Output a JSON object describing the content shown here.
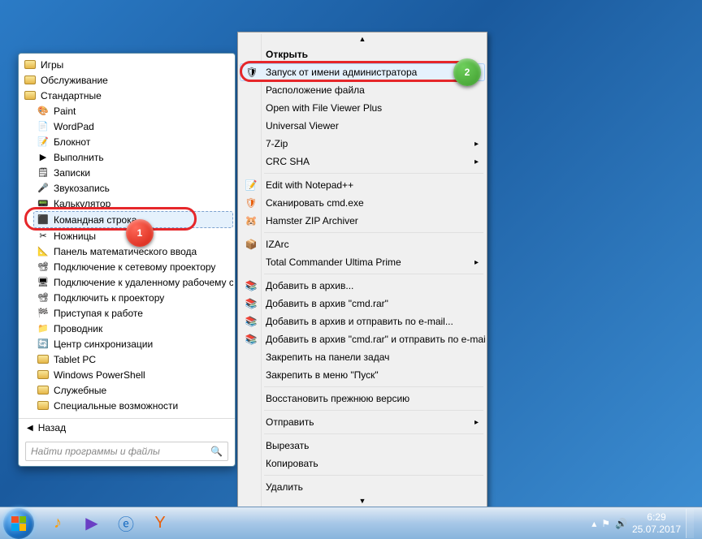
{
  "start_menu": {
    "folders_top": [
      "Игры",
      "Обслуживание",
      "Стандартные"
    ],
    "programs": [
      {
        "label": "Paint",
        "icon": "🎨"
      },
      {
        "label": "WordPad",
        "icon": "📄"
      },
      {
        "label": "Блокнот",
        "icon": "📝"
      },
      {
        "label": "Выполнить",
        "icon": "▶"
      },
      {
        "label": "Записки",
        "icon": "🗒"
      },
      {
        "label": "Звукозапись",
        "icon": "🎤"
      },
      {
        "label": "Калькулятор",
        "icon": "📟"
      },
      {
        "label": "Командная строка",
        "icon": "⬛",
        "selected": true
      },
      {
        "label": "Ножницы",
        "icon": "✂"
      },
      {
        "label": "Панель математического ввода",
        "icon": "📐"
      },
      {
        "label": "Подключение к сетевому проектору",
        "icon": "📽"
      },
      {
        "label": "Подключение к удаленному рабочему столу",
        "icon": "🖥"
      },
      {
        "label": "Подключить к проектору",
        "icon": "📽"
      },
      {
        "label": "Приступая к работе",
        "icon": "🏁"
      },
      {
        "label": "Проводник",
        "icon": "📁"
      },
      {
        "label": "Центр синхронизации",
        "icon": "🔄"
      }
    ],
    "subfolders": [
      "Tablet PC",
      "Windows PowerShell",
      "Служебные",
      "Специальные возможности"
    ],
    "back_label": "Назад",
    "search_placeholder": "Найти программы и файлы"
  },
  "context_menu": {
    "items": [
      {
        "label": "Открыть",
        "bold": true
      },
      {
        "label": "Запуск от имени администратора",
        "icon": "🛡",
        "highlighted": true
      },
      {
        "label": "Расположение файла"
      },
      {
        "label": "Open with File Viewer Plus"
      },
      {
        "label": "Universal Viewer"
      },
      {
        "label": "7-Zip",
        "arrow": true
      },
      {
        "label": "CRC SHA",
        "arrow": true
      },
      {
        "sep": true
      },
      {
        "label": "Edit with Notepad++",
        "icon": "📝"
      },
      {
        "label": "Сканировать cmd.exe",
        "icon": "🛡",
        "iconColor": "#e8600c"
      },
      {
        "label": "Hamster ZIP Archiver",
        "icon": "🐹"
      },
      {
        "sep": true
      },
      {
        "label": "IZArc",
        "icon": "📦"
      },
      {
        "label": "Total Commander Ultima Prime",
        "arrow": true
      },
      {
        "sep": true
      },
      {
        "label": "Добавить в архив...",
        "icon": "📚"
      },
      {
        "label": "Добавить в архив \"cmd.rar\"",
        "icon": "📚"
      },
      {
        "label": "Добавить в архив и отправить по e-mail...",
        "icon": "📚"
      },
      {
        "label": "Добавить в архив \"cmd.rar\" и отправить по e-mail",
        "icon": "📚"
      },
      {
        "label": "Закрепить на панели задач"
      },
      {
        "label": "Закрепить в меню \"Пуск\""
      },
      {
        "sep": true
      },
      {
        "label": "Восстановить прежнюю версию"
      },
      {
        "sep": true
      },
      {
        "label": "Отправить",
        "arrow": true
      },
      {
        "sep": true
      },
      {
        "label": "Вырезать"
      },
      {
        "label": "Копировать"
      },
      {
        "sep": true
      },
      {
        "label": "Удалить"
      }
    ]
  },
  "taskbar": {
    "time": "6:29",
    "date": "25.07.2017"
  },
  "annotations": {
    "badge1": "1",
    "badge2": "2"
  }
}
